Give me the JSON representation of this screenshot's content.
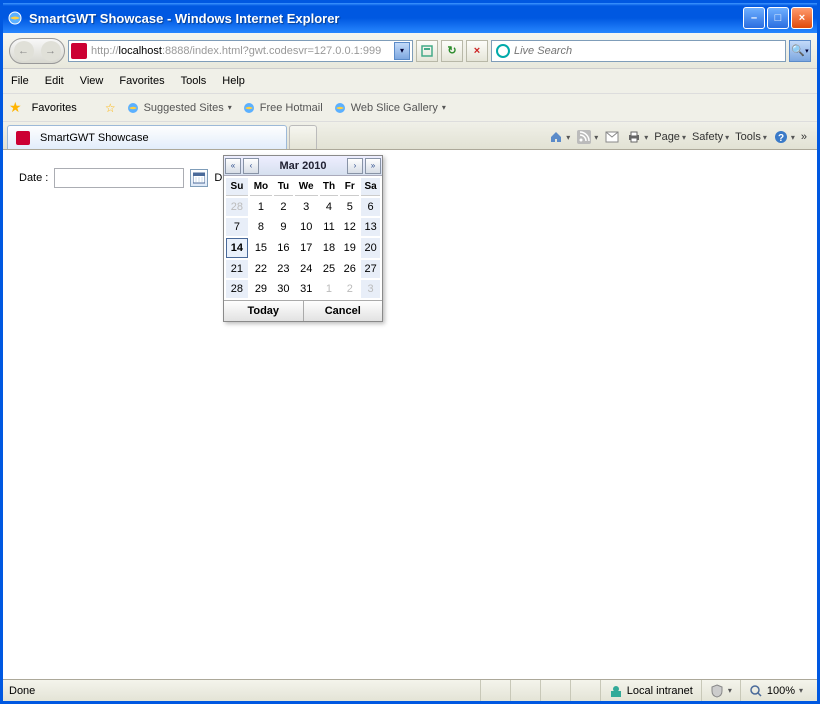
{
  "window": {
    "title": "SmartGWT Showcase - Windows Internet Explorer"
  },
  "address": {
    "protocol": "http://",
    "host": "localhost",
    "rest": ":8888/index.html?gwt.codesvr=127.0.0.1:999"
  },
  "search": {
    "placeholder": "Live Search"
  },
  "menu": {
    "file": "File",
    "edit": "Edit",
    "view": "View",
    "favorites": "Favorites",
    "tools": "Tools",
    "help": "Help"
  },
  "favbar": {
    "favorites": "Favorites",
    "suggested": "Suggested Sites",
    "hotmail": "Free Hotmail",
    "webslice": "Web Slice Gallery"
  },
  "tab": {
    "label": "SmartGWT Showcase"
  },
  "toolbar": {
    "page": "Page",
    "safety": "Safety",
    "tools": "Tools",
    "more": "»"
  },
  "form": {
    "date_label": "Date :",
    "truncated": "Di"
  },
  "calendar": {
    "title": "Mar 2010",
    "days": [
      "Su",
      "Mo",
      "Tu",
      "We",
      "Th",
      "Fr",
      "Sa"
    ],
    "weeks": [
      [
        {
          "d": "28",
          "cls": "other-month weekend"
        },
        {
          "d": "1"
        },
        {
          "d": "2"
        },
        {
          "d": "3"
        },
        {
          "d": "4"
        },
        {
          "d": "5"
        },
        {
          "d": "6",
          "cls": "weekend"
        }
      ],
      [
        {
          "d": "7",
          "cls": "weekend"
        },
        {
          "d": "8"
        },
        {
          "d": "9"
        },
        {
          "d": "10"
        },
        {
          "d": "11"
        },
        {
          "d": "12"
        },
        {
          "d": "13",
          "cls": "weekend"
        }
      ],
      [
        {
          "d": "14",
          "cls": "today weekend"
        },
        {
          "d": "15"
        },
        {
          "d": "16"
        },
        {
          "d": "17"
        },
        {
          "d": "18"
        },
        {
          "d": "19"
        },
        {
          "d": "20",
          "cls": "weekend"
        }
      ],
      [
        {
          "d": "21",
          "cls": "weekend"
        },
        {
          "d": "22"
        },
        {
          "d": "23"
        },
        {
          "d": "24"
        },
        {
          "d": "25"
        },
        {
          "d": "26"
        },
        {
          "d": "27",
          "cls": "weekend"
        }
      ],
      [
        {
          "d": "28",
          "cls": "weekend"
        },
        {
          "d": "29"
        },
        {
          "d": "30"
        },
        {
          "d": "31"
        },
        {
          "d": "1",
          "cls": "other-month"
        },
        {
          "d": "2",
          "cls": "other-month"
        },
        {
          "d": "3",
          "cls": "other-month weekend"
        }
      ]
    ],
    "today_btn": "Today",
    "cancel_btn": "Cancel"
  },
  "status": {
    "left": "Done",
    "zone": "Local intranet",
    "zoom": "100%"
  }
}
